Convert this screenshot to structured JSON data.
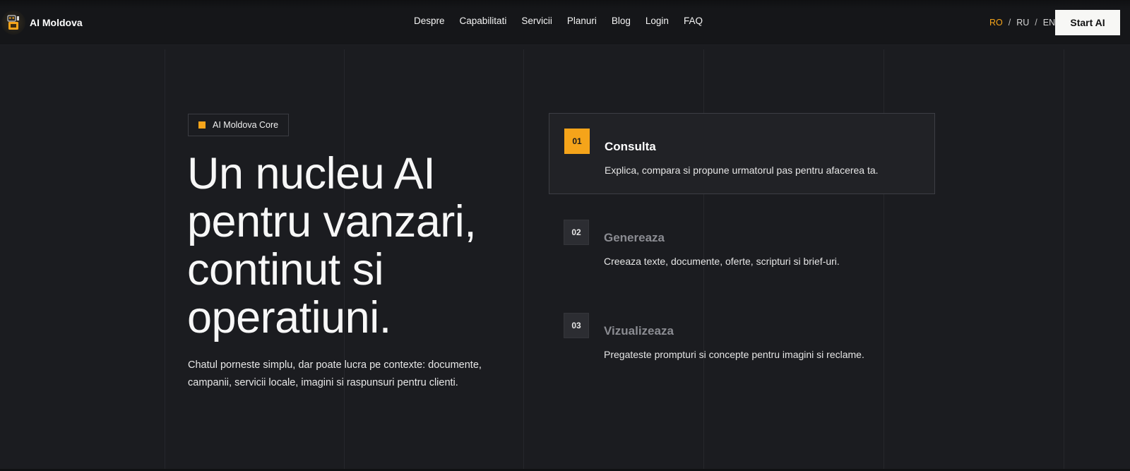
{
  "brand": {
    "name": "AI Moldova",
    "logo_icon": "robot-logo-icon"
  },
  "nav": {
    "items": [
      {
        "label": "Despre"
      },
      {
        "label": "Capabilitati"
      },
      {
        "label": "Servicii"
      },
      {
        "label": "Planuri"
      },
      {
        "label": "Blog"
      },
      {
        "label": "Login"
      },
      {
        "label": "FAQ"
      }
    ]
  },
  "language": {
    "options": [
      "RO",
      "RU",
      "EN"
    ],
    "active": "RO",
    "separator": "/"
  },
  "cta": {
    "start_label": "Start AI"
  },
  "hero": {
    "badge": "AI Moldova Core",
    "headline_lines": [
      "Un nucleu AI",
      "pentru vanzari,",
      "continut si",
      "operatiuni."
    ],
    "subtext": "Chatul porneste simplu, dar poate lucra pe contexte: documente, campanii, servicii locale, imagini si raspunsuri pentru clienti."
  },
  "steps": [
    {
      "number": "01",
      "title": "Consulta",
      "description": "Explica, compara si propune urmatorul pas pentru afacerea ta.",
      "active": true
    },
    {
      "number": "02",
      "title": "Genereaza",
      "description": "Creeaza texte, documente, oferte, scripturi si brief-uri.",
      "active": false
    },
    {
      "number": "03",
      "title": "Vizualizeaza",
      "description": "Pregateste prompturi si concepte pentru imagini si reclame.",
      "active": false
    }
  ],
  "colors": {
    "accent": "#f5a41a",
    "background": "#1b1c20",
    "header": "#151619"
  }
}
